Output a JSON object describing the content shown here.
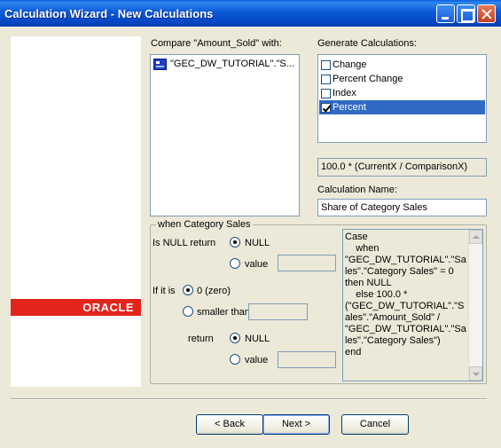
{
  "window": {
    "title": "Calculation Wizard - New Calculations"
  },
  "banner": {
    "logo_text": "ORACLE"
  },
  "compare": {
    "label": "Compare \"Amount_Sold\" with:",
    "item": "\"GEC_DW_TUTORIAL\".\"S..."
  },
  "generate": {
    "label": "Generate Calculations:",
    "items": [
      {
        "label": "Change",
        "checked": false,
        "selected": false
      },
      {
        "label": "Percent Change",
        "checked": false,
        "selected": false
      },
      {
        "label": "Index",
        "checked": false,
        "selected": false
      },
      {
        "label": "Percent",
        "checked": true,
        "selected": true
      }
    ]
  },
  "formula": "100.0 * (CurrentX / ComparisonX)",
  "calc_name": {
    "label": "Calculation Name:",
    "value": "Share of Category Sales"
  },
  "group": {
    "title": "when Category Sales",
    "is_null_label": "Is NULL return",
    "null_option": "NULL",
    "value_option": "value",
    "if_it_is_label": "If it is",
    "zero_option": "0 (zero)",
    "smaller_than_option": "smaller than",
    "return_label": "return",
    "return_null_option": "NULL",
    "return_value_option": "value"
  },
  "expression": "Case\n    when\n\"GEC_DW_TUTORIAL\".\"Sales\".\"Category Sales\" = 0\nthen NULL\n    else 100.0 *\n(\"GEC_DW_TUTORIAL\".\"Sales\".\"Amount_Sold\" /\n\"GEC_DW_TUTORIAL\".\"Sales\".\"Category Sales\")\nend",
  "buttons": {
    "back": "< Back",
    "next": "Next >",
    "cancel": "Cancel"
  }
}
